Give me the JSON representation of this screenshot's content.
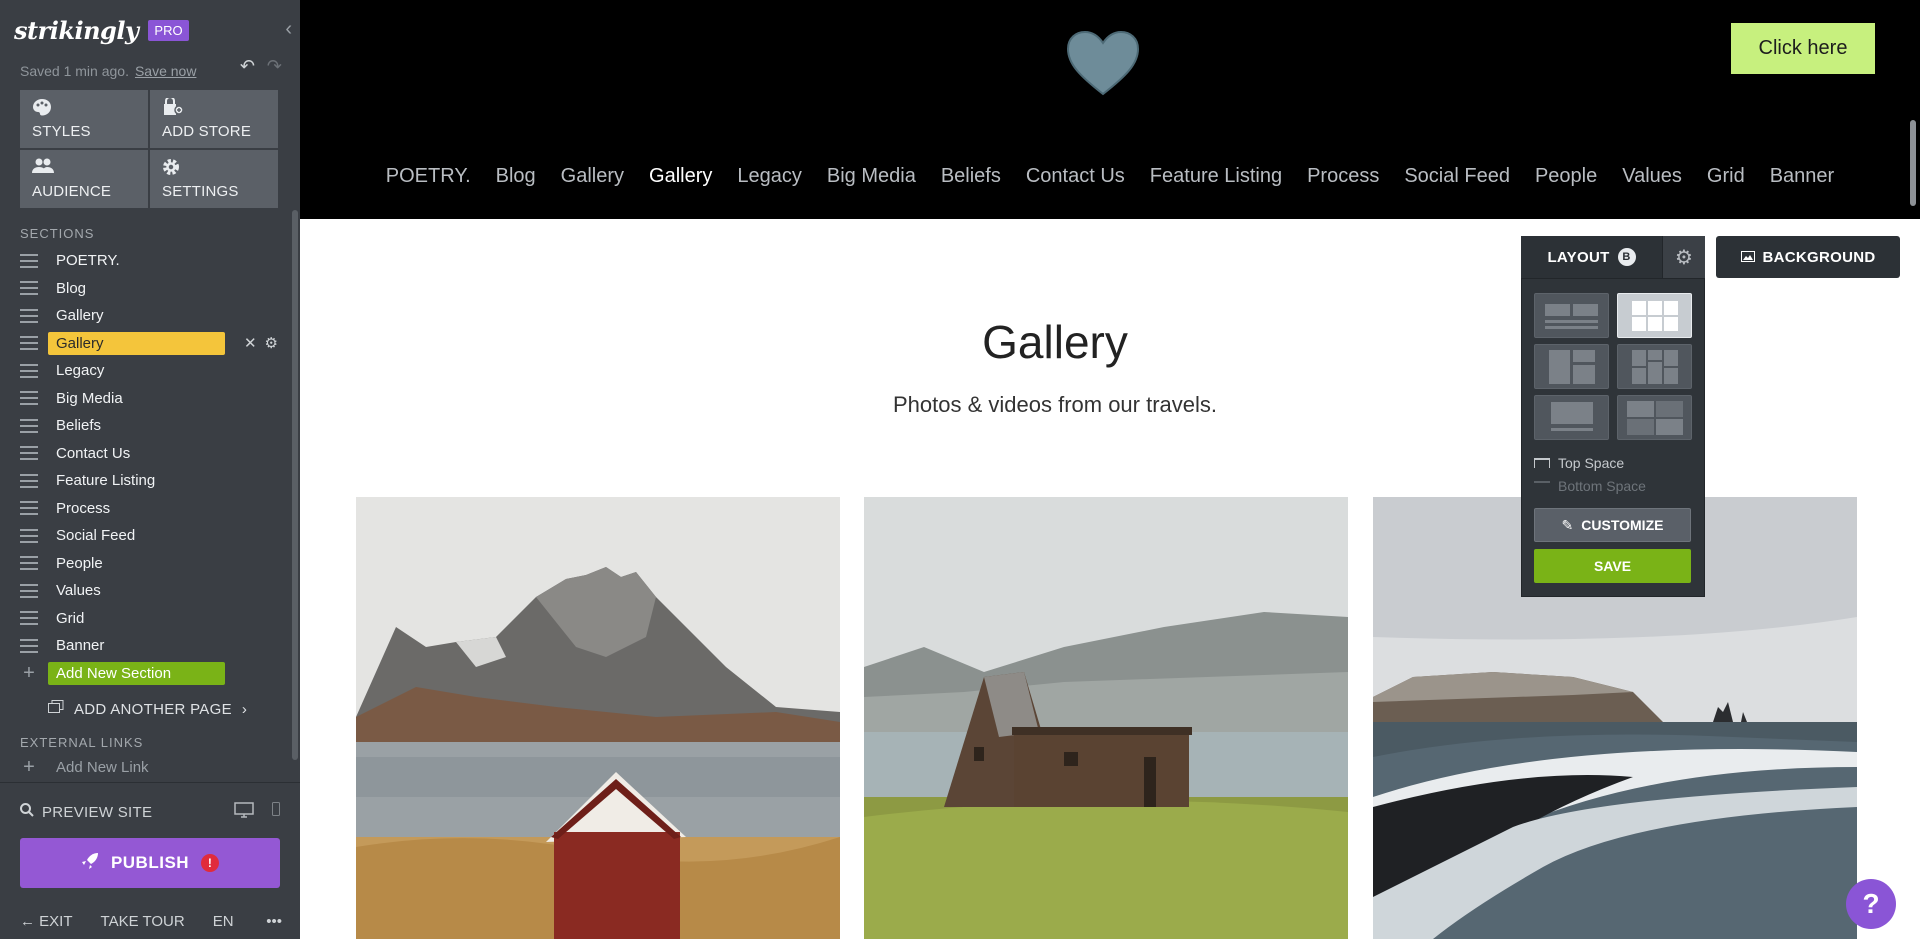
{
  "sidebar": {
    "logo": "strikingly",
    "pro_badge": "PRO",
    "saved_text": "Saved 1 min ago.",
    "save_now": "Save now",
    "tools": [
      {
        "label": "STYLES"
      },
      {
        "label": "ADD STORE"
      },
      {
        "label": "AUDIENCE"
      },
      {
        "label": "SETTINGS"
      }
    ],
    "sections_title": "SECTIONS",
    "sections": [
      "POETRY.",
      "Blog",
      "Gallery",
      "Gallery",
      "Legacy",
      "Big Media",
      "Beliefs",
      "Contact Us",
      "Feature Listing",
      "Process",
      "Social Feed",
      "People",
      "Values",
      "Grid",
      "Banner"
    ],
    "active_section_index": 3,
    "add_new_section": "Add New Section",
    "add_another_page": "ADD ANOTHER PAGE",
    "external_links_title": "EXTERNAL LINKS",
    "add_new_link": "Add New Link",
    "preview_site": "PREVIEW SITE",
    "publish": "PUBLISH",
    "publish_alert": "!",
    "exit": "EXIT",
    "take_tour": "TAKE TOUR",
    "language": "EN",
    "more": "•••"
  },
  "header": {
    "cta_label": "Click here",
    "cta_color": "#c7f07e",
    "heart_color": "#6e8c99",
    "nav": [
      "POETRY.",
      "Blog",
      "Gallery",
      "Gallery",
      "Legacy",
      "Big Media",
      "Beliefs",
      "Contact Us",
      "Feature Listing",
      "Process",
      "Social Feed",
      "People",
      "Values",
      "Grid",
      "Banner"
    ],
    "nav_active_index": 3
  },
  "gallery": {
    "title": "Gallery",
    "subtitle": "Photos & videos from our travels.",
    "photos": [
      "mountain-lake-red-cabin",
      "a-frame-cabin-field",
      "black-sand-beach-waves"
    ]
  },
  "layout_panel": {
    "layout_label": "LAYOUT",
    "layout_badge": "B",
    "background_label": "BACKGROUND",
    "top_space": "Top Space",
    "bottom_space": "Bottom Space",
    "customize": "CUSTOMIZE",
    "save": "SAVE",
    "selected_option_index": 1
  },
  "help_label": "?",
  "colors": {
    "sidebar_bg": "#3a3e44",
    "active_section": "#f4c53b",
    "green_accent": "#7ab317",
    "purple_accent": "#9458d4"
  }
}
